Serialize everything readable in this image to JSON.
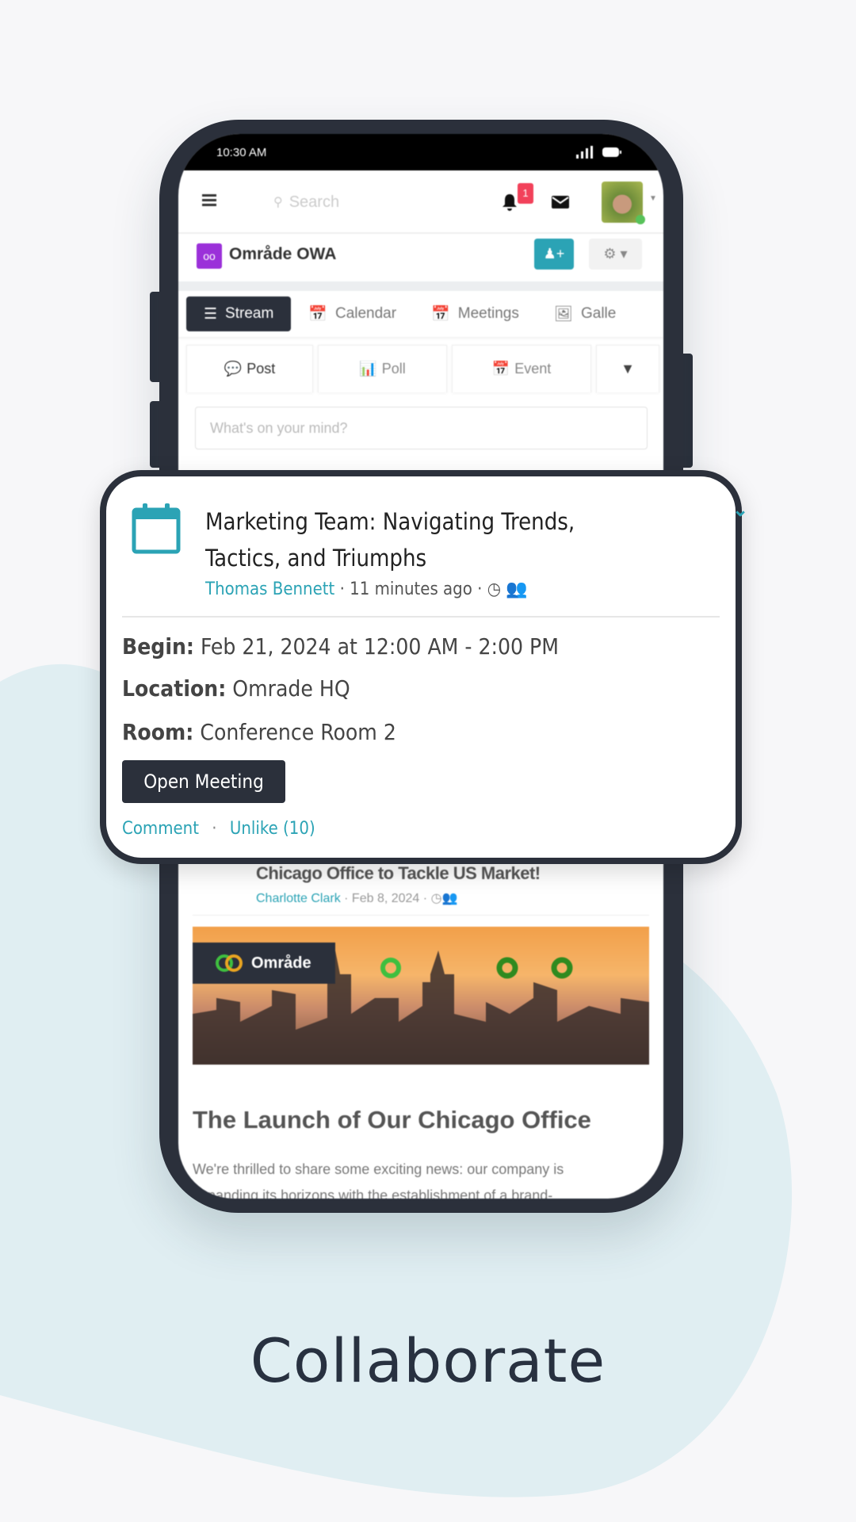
{
  "colors": {
    "accent": "#2ba3b5",
    "dark": "#2b303b",
    "badge": "#f2415a",
    "logo": "#9b30d9",
    "blob": "#e0eef2"
  },
  "status_bar": {
    "time": "10:30 AM"
  },
  "header": {
    "search_placeholder": "Search",
    "notification_count": "1"
  },
  "group": {
    "name": "Område OWA",
    "logo_glyph": "oo"
  },
  "tabs": [
    {
      "label": "Stream",
      "icon": "list-icon",
      "active": true
    },
    {
      "label": "Calendar",
      "icon": "calendar-icon"
    },
    {
      "label": "Meetings",
      "icon": "calendar-icon"
    },
    {
      "label": "Galle",
      "icon": "image-icon"
    }
  ],
  "post_tabs": [
    {
      "label": "Post",
      "icon": "comment-icon"
    },
    {
      "label": "Poll",
      "icon": "chart-icon"
    },
    {
      "label": "Event",
      "icon": "calendar-icon"
    }
  ],
  "composer": {
    "placeholder": "What's on your mind?"
  },
  "event_card": {
    "title_line1": "Marketing Team: Navigating Trends,",
    "title_line2": "Tactics, and Triumphs",
    "author": "Thomas Bennett",
    "time": "· 11 minutes ago ·",
    "begin_label": "Begin:",
    "begin_value": "Feb 21, 2024 at 12:00 AM - 2:00 PM",
    "location_label": "Location:",
    "location_value": "Omrade HQ",
    "room_label": "Room:",
    "room_value": "Conference Room 2",
    "open_button": "Open Meeting",
    "comment": "Comment",
    "sep": "·",
    "unlike": "Unlike (10)"
  },
  "post2": {
    "title": "Chicago Office to Tackle US Market!",
    "author": "Charlotte Clark",
    "date": "· Feb 8, 2024 ·",
    "image_logo_text": "Område",
    "heading": "The Launch of Our Chicago Office",
    "para_line1": "We're thrilled to share some exciting news: our company is",
    "para_line2": "expanding its horizons with the establishment of a brand-"
  },
  "tagline": "Collaborate"
}
